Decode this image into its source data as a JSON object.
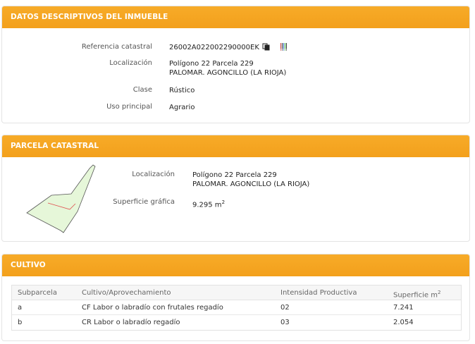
{
  "datos": {
    "title": "DATOS DESCRIPTIVOS DEL INMUEBLE",
    "referencia_label": "Referencia catastral",
    "referencia_value": "26002A022002290000EK",
    "localizacion_label": "Localización",
    "localizacion_line1": "Polígono 22 Parcela 229",
    "localizacion_line2": "PALOMAR. AGONCILLO (LA RIOJA)",
    "clase_label": "Clase",
    "clase_value": "Rústico",
    "uso_label": "Uso principal",
    "uso_value": "Agrario"
  },
  "parcela": {
    "title": "PARCELA CATASTRAL",
    "localizacion_label": "Localización",
    "localizacion_line1": "Polígono 22 Parcela 229",
    "localizacion_line2": "PALOMAR. AGONCILLO (LA RIOJA)",
    "superficie_label": "Superficie gráfica",
    "superficie_value": "9.295 m",
    "superficie_unit_sup": "2"
  },
  "cultivo": {
    "title": "CULTIVO",
    "headers": {
      "subparcela": "Subparcela",
      "cultivo": "Cultivo/Aprovechamiento",
      "intensidad": "Intensidad Productiva",
      "superficie": "Superficie m",
      "superficie_sup": "2"
    },
    "rows": [
      {
        "subparcela": "a",
        "cultivo": "CF Labor o labradío con frutales regadío",
        "intensidad": "02",
        "superficie": "7.241"
      },
      {
        "subparcela": "b",
        "cultivo": "CR Labor o labradío regadío",
        "intensidad": "03",
        "superficie": "2.054"
      }
    ]
  },
  "icons": {
    "copy": "copy-icon",
    "barcode": "barcode-icon"
  },
  "colors": {
    "header": "#f5a623",
    "parcel_fill": "#e6f7d9",
    "parcel_stroke": "#555555",
    "subparcel_line": "#e05050"
  }
}
